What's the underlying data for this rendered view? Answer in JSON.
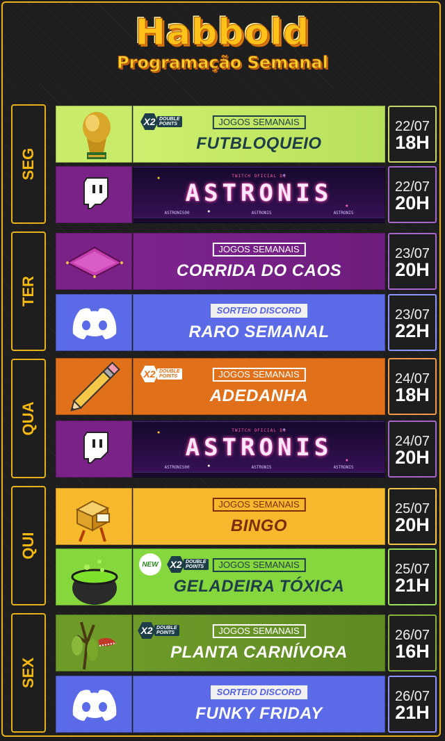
{
  "header": {
    "logo_text": "Habbold",
    "subtitle": "Programação Semanal"
  },
  "colors": {
    "background": "#1e1e1e",
    "accent": "#e8b21a",
    "lime": "#c8ec6a",
    "purple": "#7b2289",
    "discord": "#5b6ae6",
    "orange": "#e0701a",
    "yellow": "#f6b82c",
    "green": "#86d63d",
    "olive": "#6e9a2a"
  },
  "days": [
    {
      "label": "SEG"
    },
    {
      "label": "TER"
    },
    {
      "label": "QUA"
    },
    {
      "label": "QUI"
    },
    {
      "label": "SEX"
    }
  ],
  "events": [
    {
      "icon": "world-cup-trophy-icon",
      "category": "JOGOS SEMANAIS",
      "title": "FUTBLOQUEIO",
      "date": "22/07",
      "hour": "18H",
      "badge": "X2 DOUBLE POINTS"
    },
    {
      "icon": "twitch-icon",
      "type": "stream",
      "stream_top": "TWITCH OFICIAL DO",
      "stream_name": "ASTRONIS",
      "socials": [
        "ASTRONIS00",
        "ASTRONIS",
        "ASTRONIS"
      ],
      "date": "22/07",
      "hour": "20H"
    },
    {
      "icon": "cushion-icon",
      "category": "JOGOS SEMANAIS",
      "title": "CORRIDA DO CAOS",
      "date": "23/07",
      "hour": "20H"
    },
    {
      "icon": "discord-icon",
      "category": "SORTEIO DISCORD",
      "title": "RARO SEMANAL",
      "date": "23/07",
      "hour": "22H"
    },
    {
      "icon": "pencil-icon",
      "category": "JOGOS SEMANAIS",
      "title": "ADEDANHA",
      "date": "24/07",
      "hour": "18H",
      "badge": "X2 DOUBLE POINTS"
    },
    {
      "icon": "twitch-icon",
      "type": "stream",
      "stream_top": "TWITCH OFICIAL DO",
      "stream_name": "ASTRONIS",
      "socials": [
        "ASTRONIS00",
        "ASTRONIS",
        "ASTRONIS"
      ],
      "date": "24/07",
      "hour": "20H"
    },
    {
      "icon": "bingo-machine-icon",
      "category": "JOGOS SEMANAIS",
      "title": "BINGO",
      "date": "25/07",
      "hour": "20H"
    },
    {
      "icon": "cauldron-icon",
      "category": "JOGOS SEMANAIS",
      "title": "GELADEIRA TÓXICA",
      "date": "25/07",
      "hour": "21H",
      "badge": "X2 DOUBLE POINTS",
      "new": "NEW"
    },
    {
      "icon": "carnivorous-plant-icon",
      "category": "JOGOS SEMANAIS",
      "title": "PLANTA CARNÍVORA",
      "date": "26/07",
      "hour": "16H",
      "badge": "X2 DOUBLE POINTS"
    },
    {
      "icon": "discord-icon",
      "category": "SORTEIO DISCORD",
      "title": "FUNKY FRIDAY",
      "date": "26/07",
      "hour": "21H"
    }
  ],
  "badge_parts": {
    "x2": "X2",
    "double": "DOUBLE",
    "points": "POINTS"
  }
}
